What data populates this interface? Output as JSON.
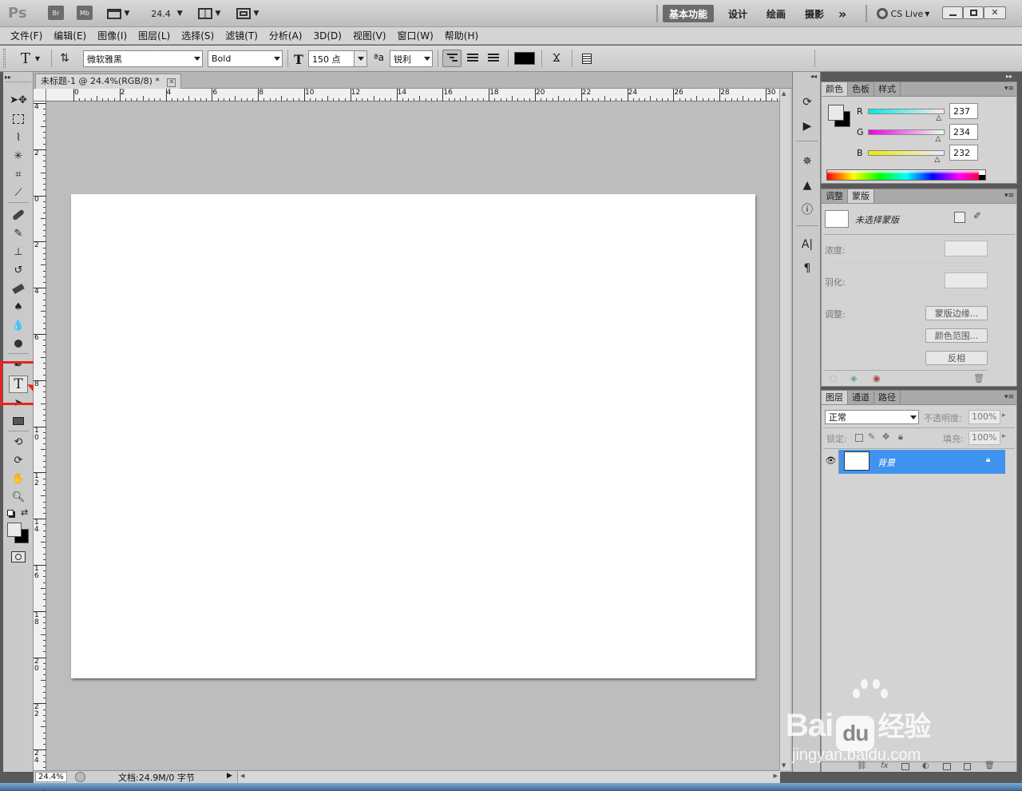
{
  "app": {
    "logo": "Ps",
    "bridge": "Br",
    "minibridge": "Mb",
    "zoom_value": "24.4",
    "workspaces": [
      "基本功能",
      "设计",
      "绘画",
      "摄影"
    ],
    "more": "»",
    "cslive": "CS Live"
  },
  "menu": [
    "文件(F)",
    "编辑(E)",
    "图像(I)",
    "图层(L)",
    "选择(S)",
    "滤镜(T)",
    "分析(A)",
    "3D(D)",
    "视图(V)",
    "窗口(W)",
    "帮助(H)"
  ],
  "options": {
    "tool_glyph": "T",
    "font_family": "微软雅黑",
    "font_style": "Bold",
    "font_size": "150 点",
    "aa_label": "ªa",
    "aa_value": "锐利",
    "text_color": "#000000"
  },
  "document": {
    "tab_title": "未标题-1 @ 24.4%(RGB/8) *",
    "h_ruler": [
      "0",
      "2",
      "4",
      "6",
      "8",
      "10",
      "12",
      "14",
      "16",
      "18",
      "20",
      "22",
      "24",
      "26",
      "28",
      "30"
    ],
    "v_ruler": [
      "4",
      "2",
      "0",
      "2",
      "4",
      "6",
      "8",
      "1\n0",
      "1\n2",
      "1\n4",
      "1\n6",
      "1\n8",
      "2\n0",
      "2\n2",
      "2\n4"
    ]
  },
  "status": {
    "zoom": "24.4%",
    "doc_info": "文档:24.9M/0 字节"
  },
  "color_panel": {
    "tabs": [
      "颜色",
      "色板",
      "样式"
    ],
    "channels": [
      {
        "label": "R",
        "value": "237",
        "slider": 0.93
      },
      {
        "label": "G",
        "value": "234",
        "slider": 0.92
      },
      {
        "label": "B",
        "value": "232",
        "slider": 0.91
      }
    ],
    "fg": "#ede9e8",
    "bg": "#000000"
  },
  "mask_panel": {
    "tabs": [
      "调整",
      "蒙版"
    ],
    "title": "未选择蒙版",
    "density_label": "浓度:",
    "feather_label": "羽化:",
    "adjust_label": "调整:",
    "buttons": [
      "蒙版边缘...",
      "颜色范围...",
      "反相"
    ]
  },
  "layers_panel": {
    "tabs": [
      "图层",
      "通道",
      "路径"
    ],
    "blend_mode": "正常",
    "opacity_label": "不透明度:",
    "opacity": "100%",
    "lock_label": "锁定:",
    "fill_label": "填充:",
    "fill": "100%",
    "layer_name": "背景",
    "fx": "fx"
  },
  "annotation": {
    "highlight_color": "#e8241f"
  },
  "watermark": {
    "brand": "Bai",
    "brand2": "du",
    "product": "经验",
    "url": "jingyan.baidu.com"
  }
}
